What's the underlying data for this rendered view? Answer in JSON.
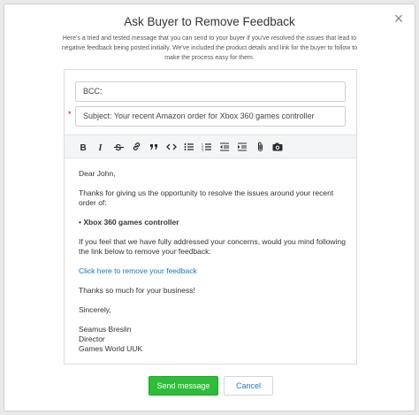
{
  "modal": {
    "title": "Ask Buyer to Remove Feedback",
    "intro": "Here's a tried and tested message that you can send to your buyer if you've resolved the issues that lead to negative feedback being posted initially. We've included the product details and link for the buyer to follow to make the process easy for them.",
    "close_icon": "×"
  },
  "form": {
    "bcc_label": "BCC:",
    "subject_required_mark": "*",
    "subject": "Subject:  Your recent Amazon order for Xbox 360 games controller"
  },
  "toolbar": {
    "icons": [
      "bold-icon",
      "italic-icon",
      "strikethrough-icon",
      "link-icon",
      "quote-icon",
      "code-icon",
      "bullet-list-icon",
      "numbered-list-icon",
      "outdent-icon",
      "indent-icon",
      "attachment-icon",
      "camera-icon"
    ]
  },
  "message": {
    "greeting": "Dear John,",
    "line1": "Thanks for giving us the opportunity to resolve the issues around your recent order of:",
    "item": "• Xbox 360 games controller",
    "line2": "If you feel that we have fully addressed your concerns, would you mind following the link below to remove your feedback:",
    "link_text": "Click here to remove your feedback",
    "thanks": "Thanks so much for your business!",
    "signoff": "Sincerely,",
    "sig_name": "Seamus Breslin",
    "sig_title": "Director",
    "sig_company": "Games World UUK"
  },
  "actions": {
    "send_label": "Send message",
    "cancel_label": "Cancel"
  },
  "colors": {
    "send_button": "#2dbd38",
    "link": "#1b76c4",
    "required": "#d0021b"
  }
}
